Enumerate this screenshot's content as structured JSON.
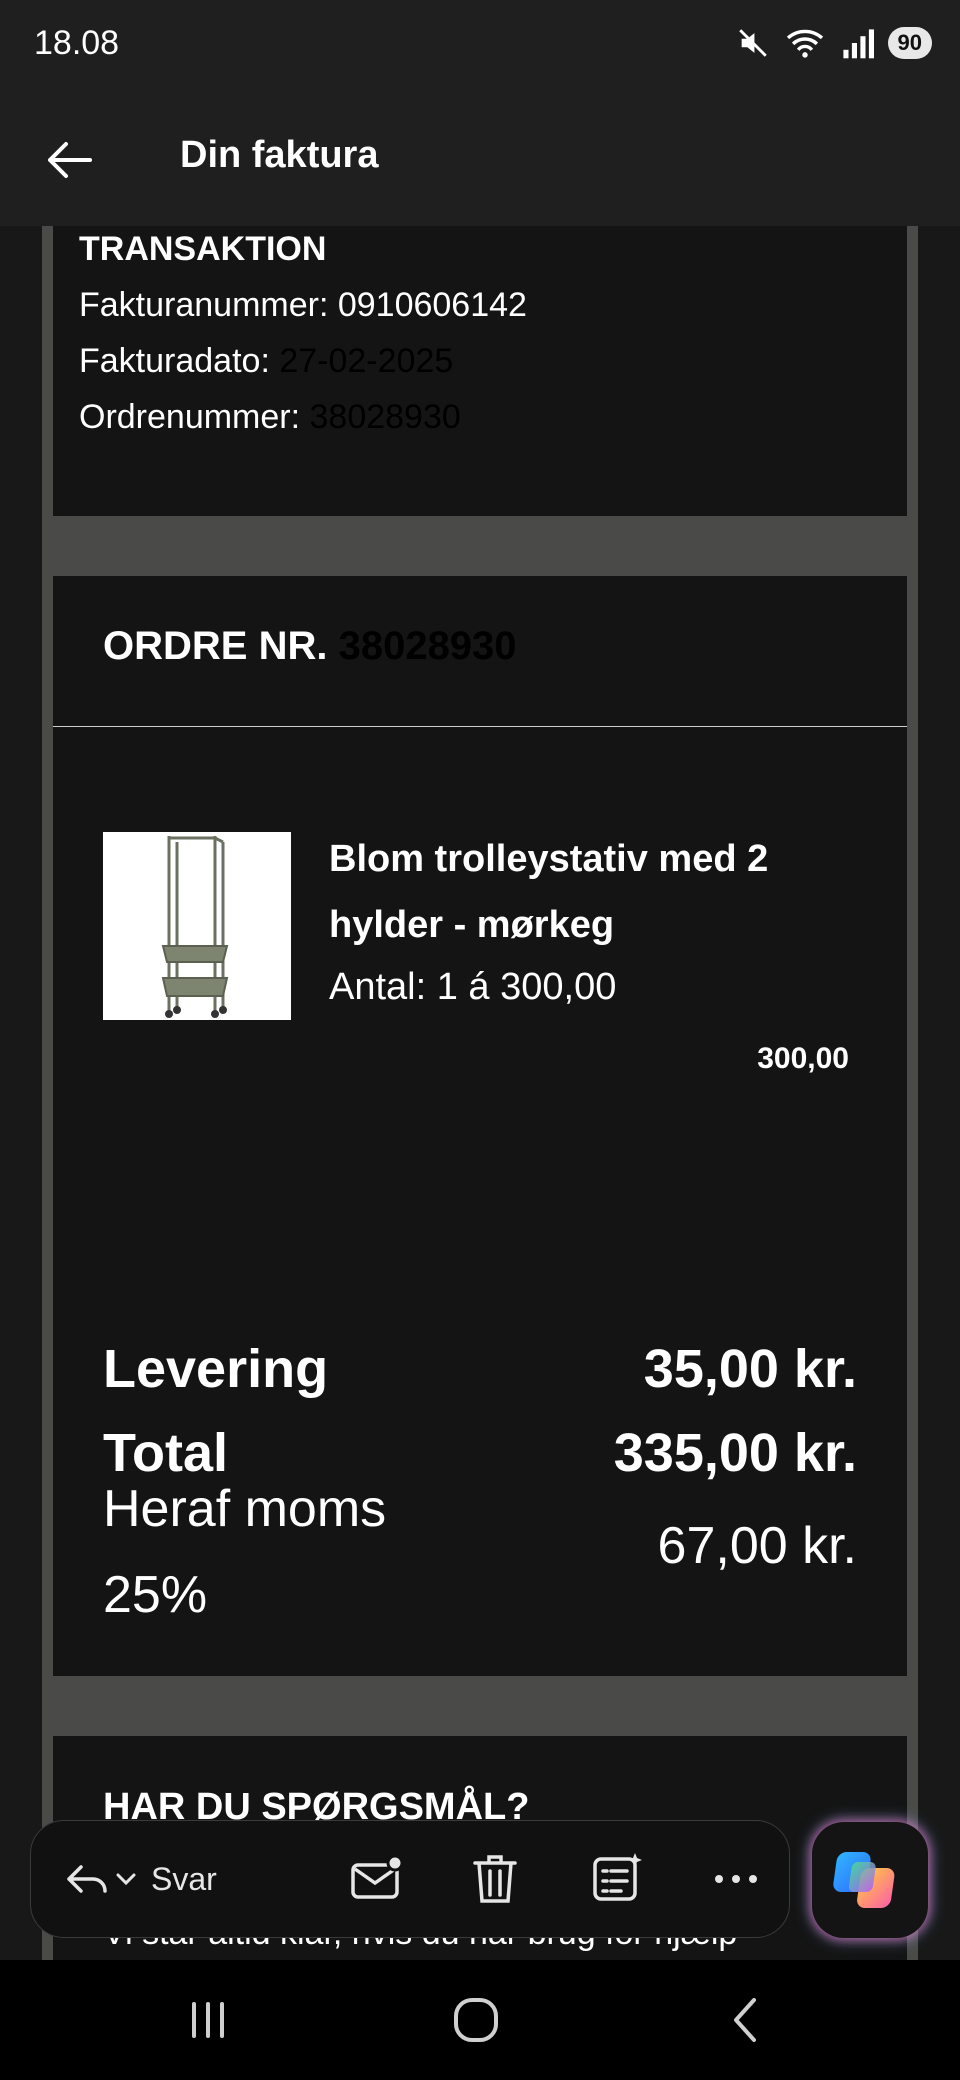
{
  "status_bar": {
    "time": "18.08",
    "battery": "90"
  },
  "app_bar": {
    "title": "Din faktura"
  },
  "transaction": {
    "title": "TRANSAKTION",
    "invoice_number": "Fakturanummer: 0910606142",
    "invoice_date_label": "Fakturadato:",
    "invoice_date_value": "27-02-2025",
    "order_number_label": "Ordrenummer:",
    "order_number_value": "38028930"
  },
  "order": {
    "heading_label": "ORDRE NR.",
    "heading_value": "38028930",
    "product": {
      "name": "Blom trolleystativ med 2 hylder - mørkeg",
      "quantity": "Antal: 1 á 300,00",
      "price": "300,00"
    },
    "delivery_label": "Levering",
    "delivery_value": "35,00 kr.",
    "total_label": "Total",
    "total_value": "335,00 kr.",
    "vat_label": "Heraf moms 25%",
    "vat_value": "67,00 kr."
  },
  "questions": {
    "title": "HAR DU SPØRGSMÅL?",
    "text": "Vi står altid klar, hvis du har brug for hjælp"
  },
  "toolbar": {
    "reply_label": "Svar"
  },
  "colors": {
    "card": "#141414",
    "frame": "#4a4b48",
    "bar": "#1f1f1f"
  }
}
